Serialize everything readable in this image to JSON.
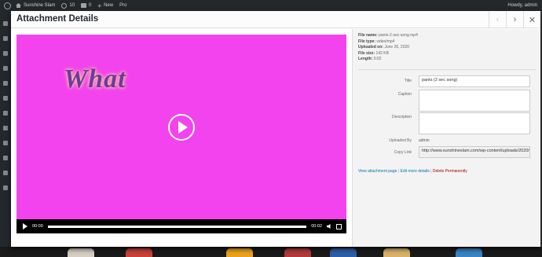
{
  "adminbar": {
    "site_name": "Sunshine Slam",
    "updates": "10",
    "comments": "0",
    "new_label": "New",
    "pro_label": "Pro",
    "howdy": "Howdy, admin"
  },
  "modal": {
    "title": "Attachment Details",
    "prev_icon": "‹",
    "next_icon": "›",
    "close_icon": "✕"
  },
  "video": {
    "overlay_text": "What",
    "time_current": "00:00",
    "time_total": "00:02",
    "background_color": "#f243ee"
  },
  "details": {
    "file_name_label": "File name:",
    "file_name": "pants-2-sec-song.mp4",
    "file_type_label": "File type:",
    "file_type": "video/mp4",
    "uploaded_on_label": "Uploaded on:",
    "uploaded_on": "June 26, 2020",
    "file_size_label": "File size:",
    "file_size": "142 KB",
    "length_label": "Length:",
    "length": "0:02"
  },
  "fields": {
    "title_label": "Title",
    "title_value": "pants (2 sec song)",
    "caption_label": "Caption",
    "caption_value": "",
    "description_label": "Description",
    "description_value": "",
    "uploaded_by_label": "Uploaded By",
    "uploaded_by_value": "admin",
    "copy_link_label": "Copy Link",
    "copy_link_value": "http://www.sunshineslam.com/wp-content/uploads/2020/06/pants-2-sec-song.mp4"
  },
  "actions": {
    "view_page": "View attachment page",
    "edit_details": "Edit more details",
    "delete": "Delete Permanently",
    "separator": "|"
  }
}
